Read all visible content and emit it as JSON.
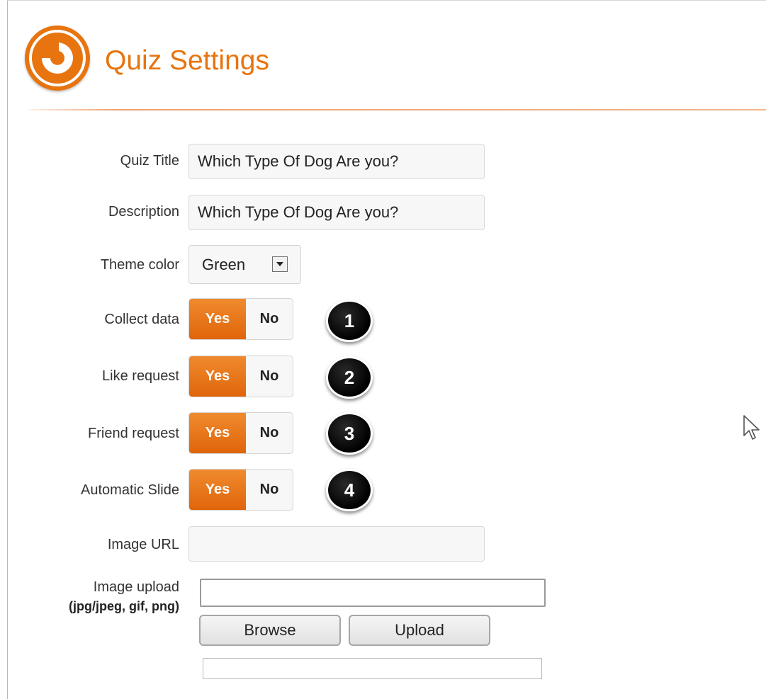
{
  "header": {
    "title": "Quiz Settings",
    "accent_color": "#e8740f",
    "logo_icon": "target-logo-icon"
  },
  "form": {
    "quiz_title": {
      "label": "Quiz Title",
      "value": "Which Type Of Dog Are you?"
    },
    "description": {
      "label": "Description",
      "value": "Which Type Of Dog Are you?"
    },
    "theme_color": {
      "label": "Theme color",
      "value": "Green"
    },
    "toggles": [
      {
        "label": "Collect data",
        "yes": "Yes",
        "no": "No",
        "selected": "Yes",
        "callout": "1"
      },
      {
        "label": "Like request",
        "yes": "Yes",
        "no": "No",
        "selected": "Yes",
        "callout": "2"
      },
      {
        "label": "Friend request",
        "yes": "Yes",
        "no": "No",
        "selected": "Yes",
        "callout": "3"
      },
      {
        "label": "Automatic Slide",
        "yes": "Yes",
        "no": "No",
        "selected": "Yes",
        "callout": "4"
      }
    ],
    "image_url": {
      "label": "Image URL",
      "value": ""
    },
    "image_upload": {
      "label": "Image upload",
      "formats": "(jpg/jpeg, gif, png)",
      "browse_label": "Browse",
      "upload_label": "Upload"
    }
  }
}
